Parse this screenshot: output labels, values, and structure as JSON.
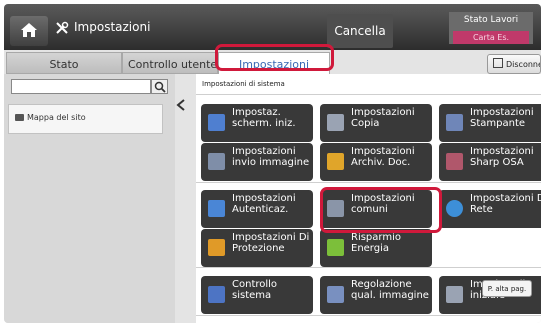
{
  "header": {
    "title": "Impostazioni",
    "cancel_label": "Cancella",
    "status": {
      "label": "Stato Lavori",
      "warning": "Carta Es."
    }
  },
  "tabs": {
    "stato": "Stato",
    "controllo": "Controllo utente",
    "impostazioni": "Impostazioni",
    "logout": "Disconnetti"
  },
  "sidebar": {
    "search_placeholder": "",
    "sitemap_label": "Mappa del sito"
  },
  "main": {
    "section_title": "Impostazioni di sistema",
    "tiles": [
      {
        "line1": "Impostaz.",
        "line2": "scherm. iniz.",
        "icon": "home-icon",
        "color": "#4f7fd0"
      },
      {
        "line1": "Impostazioni",
        "line2": "Copia",
        "icon": "copy-icon",
        "color": "#9aa3b3"
      },
      {
        "line1": "Impostazioni",
        "line2": "Stampante",
        "icon": "printer-icon",
        "color": "#6f86b8"
      },
      {
        "line1": "Impostazioni",
        "line2": "invio immagine",
        "icon": "send-image-icon",
        "color": "#7f8ea8"
      },
      {
        "line1": "Impostazioni",
        "line2": "Archiv. Doc.",
        "icon": "folder-icon",
        "color": "#e0a52a"
      },
      {
        "line1": "Impostazioni",
        "line2": "Sharp OSA",
        "icon": "osa-icon",
        "color": "#b0576b"
      },
      {
        "line1": "Impostazioni",
        "line2": "Autenticaz.",
        "icon": "users-icon",
        "color": "#4a86d6"
      },
      {
        "line1": "Impostazioni",
        "line2": "comuni",
        "icon": "common-settings-icon",
        "color": "#8a95a8"
      },
      {
        "line1": "Impostazioni Di",
        "line2": "Rete",
        "icon": "globe-icon",
        "color": "#3d8fd8"
      },
      {
        "line1": "Impostazioni Di",
        "line2": "Protezione",
        "icon": "lock-icon",
        "color": "#e09a28"
      },
      {
        "line1": "Risparmio",
        "line2": "Energia",
        "icon": "leaf-icon",
        "color": "#7cbf3a"
      },
      {
        "line1": "Controllo",
        "line2": "sistema",
        "icon": "monitor-icon",
        "color": "#4d74c4"
      },
      {
        "line1": "Regolazione",
        "line2": "qual. immagine",
        "icon": "image-quality-icon",
        "color": "#7990c0"
      },
      {
        "line1": "Imp. install.",
        "line2": "iniziale",
        "icon": "install-icon",
        "color": "#9aa3b3"
      }
    ],
    "top_page_label": "P. alta pag."
  }
}
